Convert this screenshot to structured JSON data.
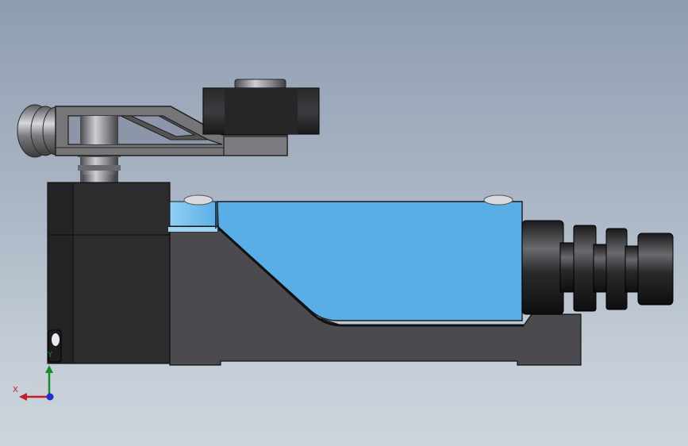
{
  "axis_triad": {
    "x_label": "X",
    "y_label": "Y"
  },
  "colors": {
    "housing_blue": "#5aaee6",
    "base_dark": "#4b4b4f",
    "block_black": "#2b2b2d",
    "cable_gland": "#1c1c1e",
    "lever_gray": "#6e6e72",
    "axis_x": "#c0202a",
    "axis_y": "#1a8a2a",
    "axis_z": "#1f2fd0"
  }
}
